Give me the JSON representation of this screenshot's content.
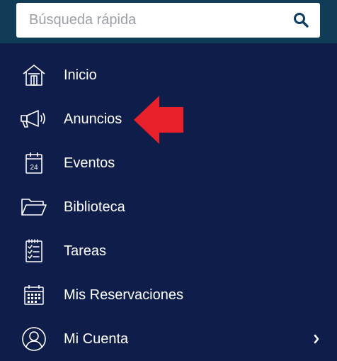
{
  "search": {
    "placeholder": "Búsqueda rápida",
    "icon": "search-icon"
  },
  "menu": {
    "items": [
      {
        "label": "Inicio",
        "icon": "home-icon"
      },
      {
        "label": "Anuncios",
        "icon": "megaphone-icon"
      },
      {
        "label": "Eventos",
        "icon": "calendar-icon",
        "calendar_day": "24"
      },
      {
        "label": "Biblioteca",
        "icon": "folder-icon"
      },
      {
        "label": "Tareas",
        "icon": "checklist-icon"
      },
      {
        "label": "Mis Reservaciones",
        "icon": "calendar-grid-icon"
      },
      {
        "label": "Mi Cuenta",
        "icon": "user-circle-icon",
        "has_submenu": true
      }
    ]
  },
  "annotation": {
    "icon": "red-arrow-icon",
    "color": "#e8202a"
  },
  "colors": {
    "background": "#0f1d4a",
    "header": "#113c58",
    "text": "#ffffff"
  }
}
